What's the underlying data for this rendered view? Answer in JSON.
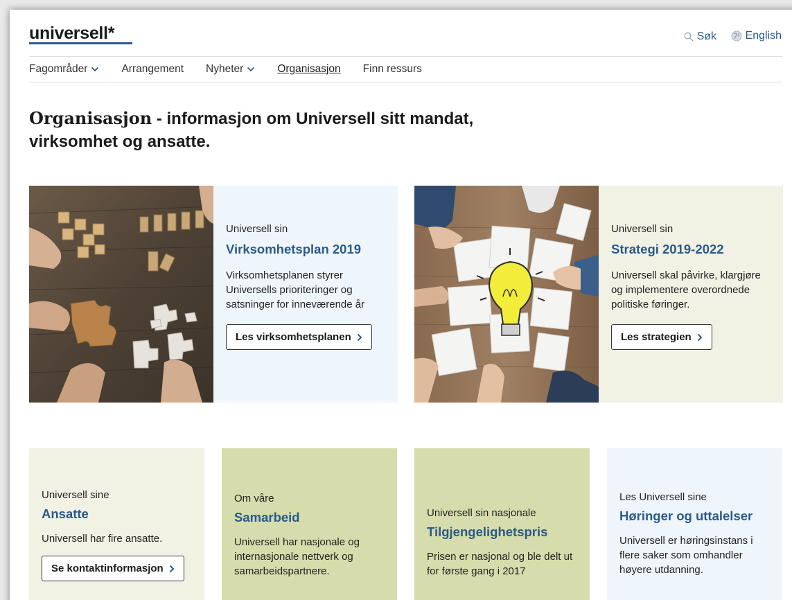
{
  "header": {
    "logo": "universell*",
    "search_label": "Søk",
    "language_label": "English"
  },
  "nav": {
    "items": [
      {
        "label": "Fagområder",
        "dropdown": true
      },
      {
        "label": "Arrangement",
        "dropdown": false
      },
      {
        "label": "Nyheter",
        "dropdown": true
      },
      {
        "label": "Organisasjon",
        "dropdown": false,
        "active": true
      },
      {
        "label": "Finn ressurs",
        "dropdown": false
      }
    ]
  },
  "page": {
    "title_bold": "Organisasjon",
    "title_rest": " - informasjon om Universell sitt mandat, virksomhet og ansatte."
  },
  "features": [
    {
      "eyebrow": "Universell sin",
      "title": "Virksomhetsplan 2019",
      "description": "Virksomhetsplanen styrer Universells prioriteringer og satsninger for inneværende år",
      "button": "Les virksomhetsplanen",
      "image": "wooden-blocks-puzzle-photo"
    },
    {
      "eyebrow": "Universell sin",
      "title": "Strategi 2019-2022",
      "description": "Universell skal påvirke, klargjøre og implementere overordnede politiske føringer.",
      "button": "Les strategien",
      "image": "lightbulb-puzzle-photo"
    }
  ],
  "cards": [
    {
      "eyebrow": "Universell sine",
      "title": "Ansatte",
      "description": "Universell har fire ansatte.",
      "button": "Se kontaktinformasjon"
    },
    {
      "eyebrow": "Om våre",
      "title": "Samarbeid",
      "description": "Universell har nasjonale og internasjonale nettverk og samarbeidspartnere."
    },
    {
      "eyebrow": "Universell sin nasjonale",
      "title": "Tilgjengelighetspris",
      "description": "Prisen er nasjonal og ble delt ut for første gang i 2017"
    },
    {
      "eyebrow": "Les Universell sine",
      "title": "Høringer og uttalelser",
      "description": "Universell er høringsinstans i flere saker som omhandler høyere utdanning."
    }
  ],
  "colors": {
    "link_blue": "#2a5a8a",
    "light_blue": "#eef6fc",
    "beige": "#f1f1e4",
    "olive": "#d6dcab"
  }
}
